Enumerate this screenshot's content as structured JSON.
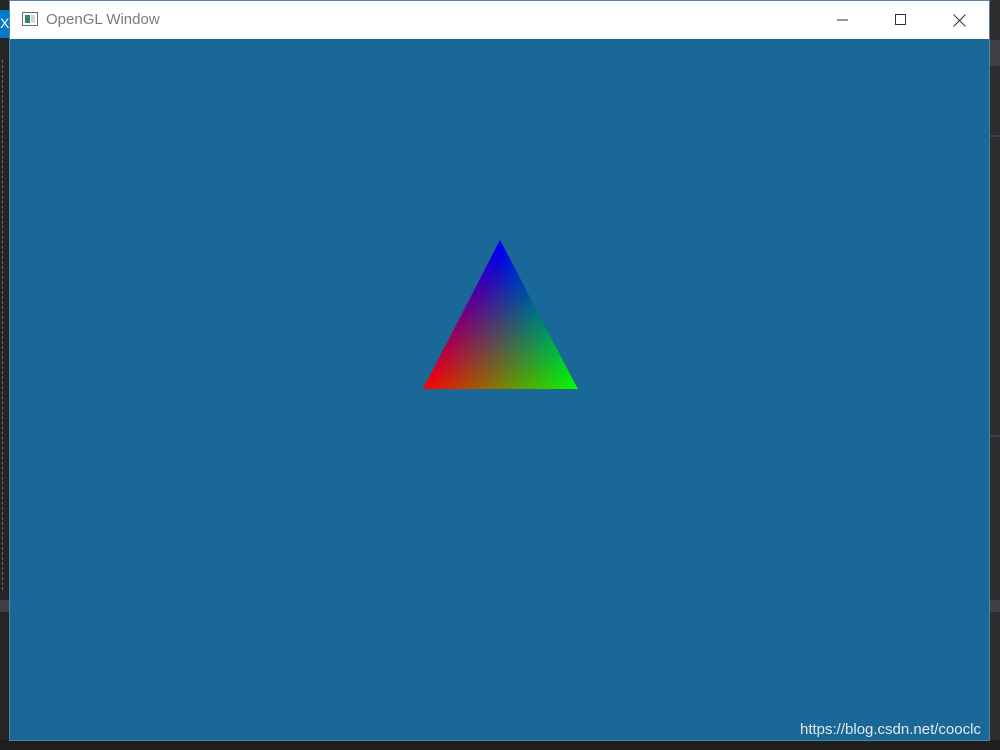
{
  "window": {
    "title": "OpenGL Window",
    "background_color": "#1a6898",
    "icon": "app-window-icon"
  },
  "controls": {
    "minimize_icon": "minimize-icon",
    "maximize_icon": "maximize-icon",
    "close_icon": "close-icon"
  },
  "triangle": {
    "vertex_colors": {
      "top": "#0000ff",
      "bottom_left": "#ff0000",
      "bottom_right": "#00ff00"
    }
  },
  "background_ide": {
    "left_accent_glyph": "X"
  },
  "watermark": {
    "text": "https://blog.csdn.net/cooclc"
  }
}
